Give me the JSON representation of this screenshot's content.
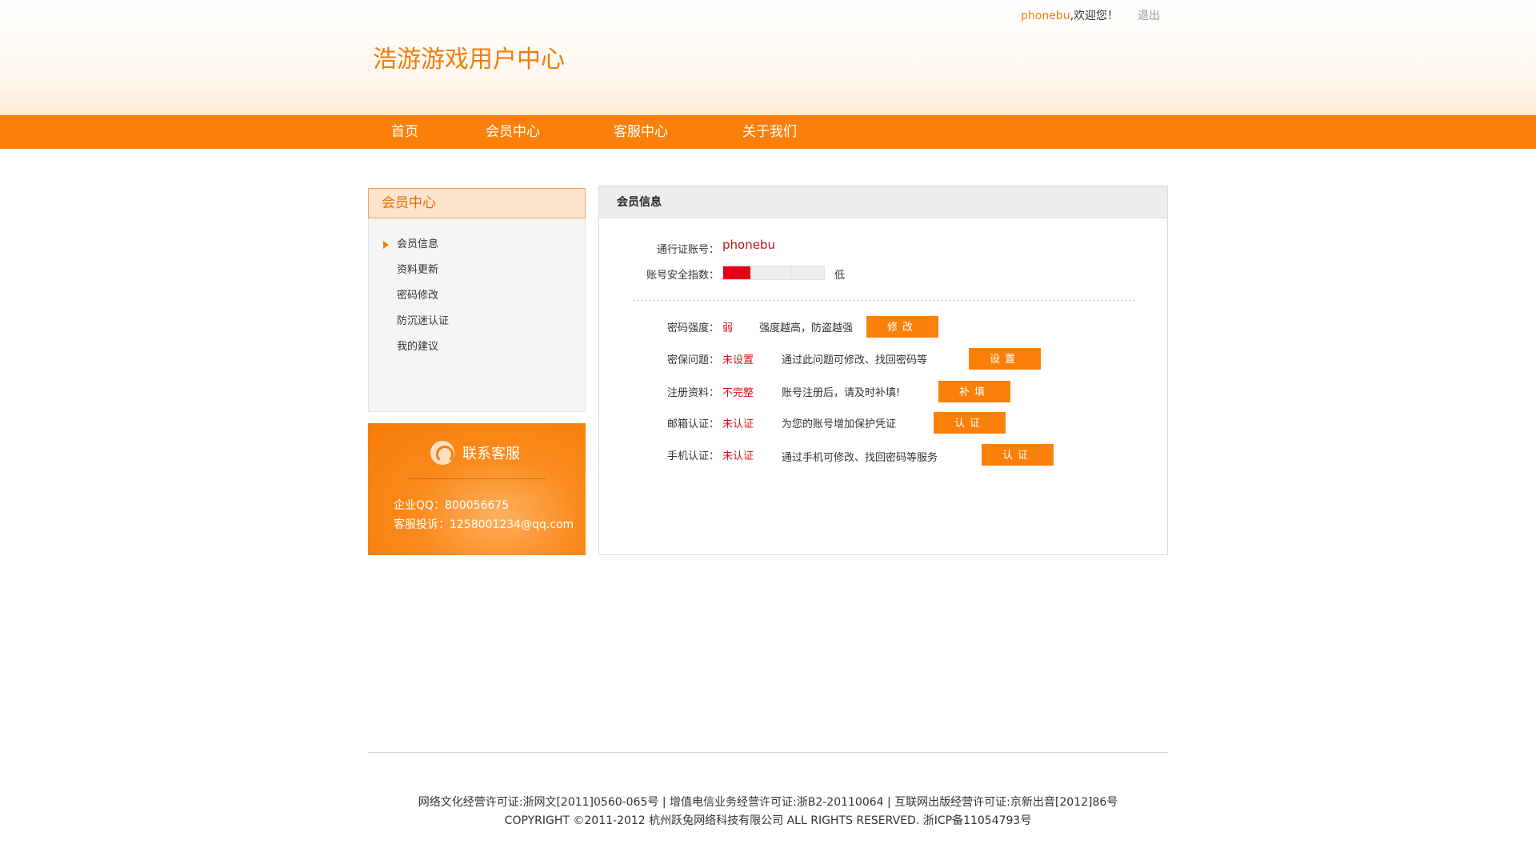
{
  "header": {
    "username": "phonebu",
    "welcome": ",欢迎您！",
    "logout": "退出",
    "site_title": "浩游游戏用户中心"
  },
  "nav": {
    "items": [
      {
        "label": "首页"
      },
      {
        "label": "会员中心"
      },
      {
        "label": "客服中心"
      },
      {
        "label": "关于我们"
      }
    ]
  },
  "sidebar": {
    "title": "会员中心",
    "items": [
      {
        "label": "会员信息",
        "active": true
      },
      {
        "label": "资料更新"
      },
      {
        "label": "密码修改"
      },
      {
        "label": "防沉迷认证"
      },
      {
        "label": "我的建议"
      }
    ]
  },
  "service": {
    "title": "联系客服",
    "qq": "企业QQ：800056675",
    "complaint": "客服投诉：1258001234@qq.com"
  },
  "main": {
    "title": "会员信息",
    "account_label": "通行证账号：",
    "account_value": "phonebu",
    "security_label": "账号安全指数：",
    "security_level_fraction": 0.27,
    "security_level_text": "低",
    "rows": [
      {
        "label": "密码强度：",
        "status": "弱",
        "desc": "强度越高，防盗越强",
        "button": "修改"
      },
      {
        "label": "密保问题：",
        "status": "未设置",
        "desc": "通过此问题可修改、找回密码等",
        "button": "设置"
      },
      {
        "label": "注册资料：",
        "status": "不完整",
        "desc": "账号注册后，请及时补填!",
        "button": "补填"
      },
      {
        "label": "邮箱认证：",
        "status": "未认证",
        "desc": "为您的账号增加保护凭证",
        "button": "认证"
      },
      {
        "label": "手机认证：",
        "status": "未认证",
        "desc": "通过手机可修改、找回密码等服务",
        "button": "认证"
      }
    ]
  },
  "footer": {
    "line1": "网络文化经营许可证:浙网文[2011]0560-065号 | 增值电信业务经营许可证:浙B2-20110064 | 互联网出版经营许可证:京新出音[2012]86号",
    "line2": "COPYRIGHT ©2011-2012 杭州跃兔网络科技有限公司 ALL RIGHTS RESERVED.  浙ICP备11054793号"
  },
  "colors": {
    "accent": "#fa8009",
    "title": "#f07e0c",
    "status_red": "#d8141c",
    "meter_red": "#e60012"
  }
}
